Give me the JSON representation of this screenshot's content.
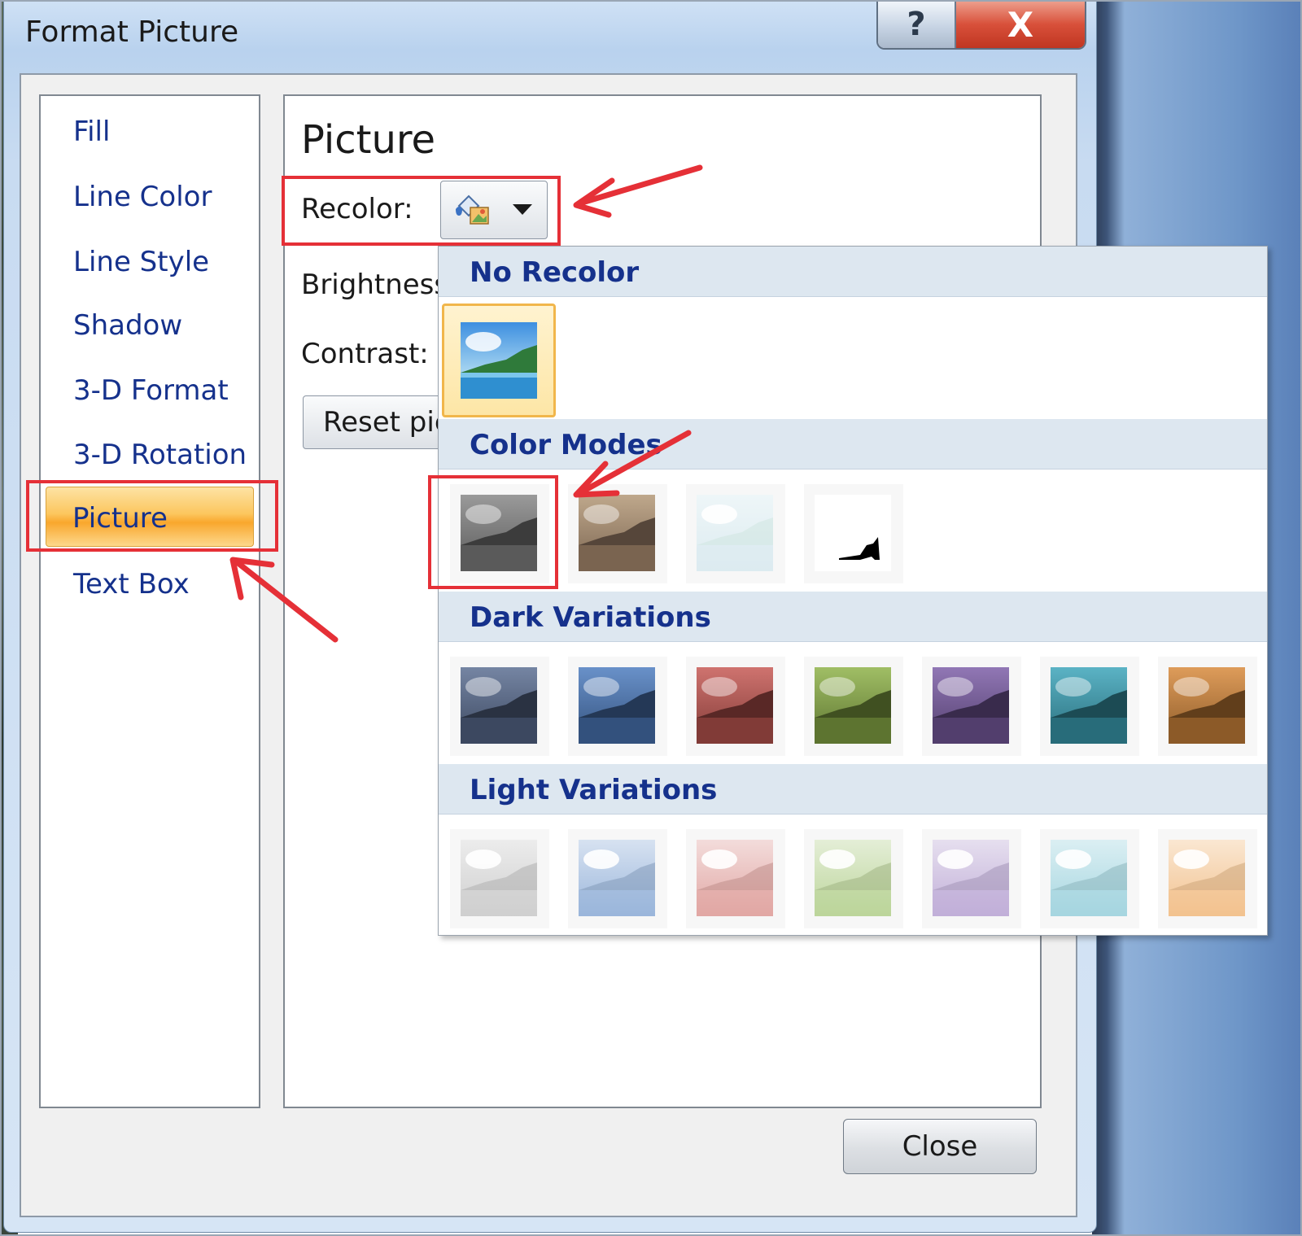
{
  "window": {
    "title": "Format Picture",
    "help_glyph": "?",
    "close_glyph": "X"
  },
  "nav": {
    "items": [
      {
        "label": "Fill"
      },
      {
        "label": "Line Color"
      },
      {
        "label": "Line Style"
      },
      {
        "label": "Shadow"
      },
      {
        "label": "3-D Format"
      },
      {
        "label": "3-D Rotation"
      },
      {
        "label": "Picture",
        "selected": true
      },
      {
        "label": "Text Box"
      }
    ]
  },
  "content": {
    "title": "Picture",
    "recolor_label": "Recolor:",
    "recolor_icon": "recolor-icon",
    "brightness_label": "Brightness",
    "contrast_label": "Contrast:",
    "reset_label": "Reset pic"
  },
  "gallery": {
    "no_recolor_header": "No Recolor",
    "color_modes_header": "Color Modes",
    "dark_variations_header": "Dark Variations",
    "light_variations_header": "Light Variations",
    "color_modes": [
      "grayscale",
      "sepia",
      "washout",
      "black-and-white"
    ],
    "dark_colors": [
      "#5d6f93",
      "#4f7dc0",
      "#c65a55",
      "#8fb24a",
      "#7e5fa8",
      "#3ea6bb",
      "#d88a3d"
    ],
    "light_colors": [
      "#cfcfcf",
      "#9ab6db",
      "#e1a7a4",
      "#bcd59a",
      "#c1afd8",
      "#a6d6e0",
      "#f2c28f"
    ]
  },
  "footer": {
    "close_label": "Close"
  },
  "colors": {
    "accent_text": "#15318c",
    "annotation": "#e53037",
    "selected_gradient": "#f9a72d"
  }
}
